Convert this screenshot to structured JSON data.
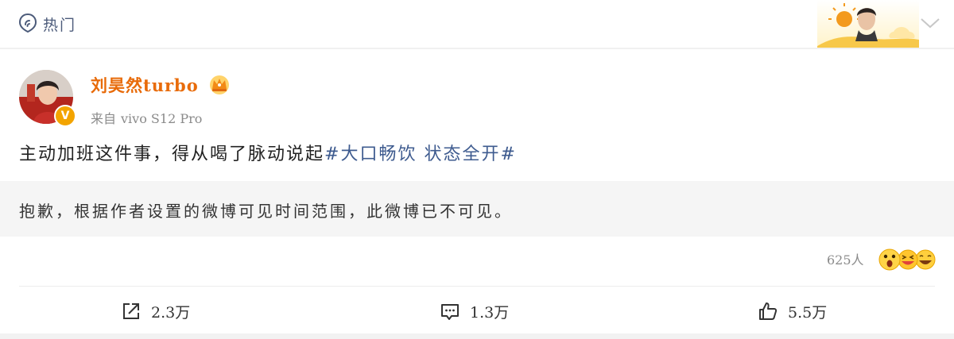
{
  "header": {
    "section_label": "热门",
    "icons": {
      "section": "location-pin-icon",
      "collapse": "chevron-down-icon"
    }
  },
  "post": {
    "author": {
      "name": "刘昊然turbo",
      "verified_badge": "V",
      "badge_icon": "crown-icon"
    },
    "source": {
      "prefix": "来自",
      "device": "vivo S12 Pro"
    },
    "text": "主动加班这件事，得从喝了脉动说起",
    "hashtag": "#大口畅饮 状态全开#",
    "notice": "抱歉，根据作者设置的微博可见时间范围，此微博已不可见。",
    "reactions": {
      "count_label": "625人",
      "emojis": [
        "surprised-emoji-icon",
        "laughing-emoji-icon",
        "grinning-emoji-icon"
      ]
    },
    "actions": {
      "share": {
        "label": "2.3万",
        "icon": "share-icon"
      },
      "comment": {
        "label": "1.3万",
        "icon": "comment-icon"
      },
      "like": {
        "label": "5.5万",
        "icon": "thumbs-up-icon"
      }
    }
  },
  "colors": {
    "username": "#e86b0a",
    "hashtag": "#3e5b8f",
    "header_label": "#4c5b7a",
    "verified": "#f3a400"
  }
}
